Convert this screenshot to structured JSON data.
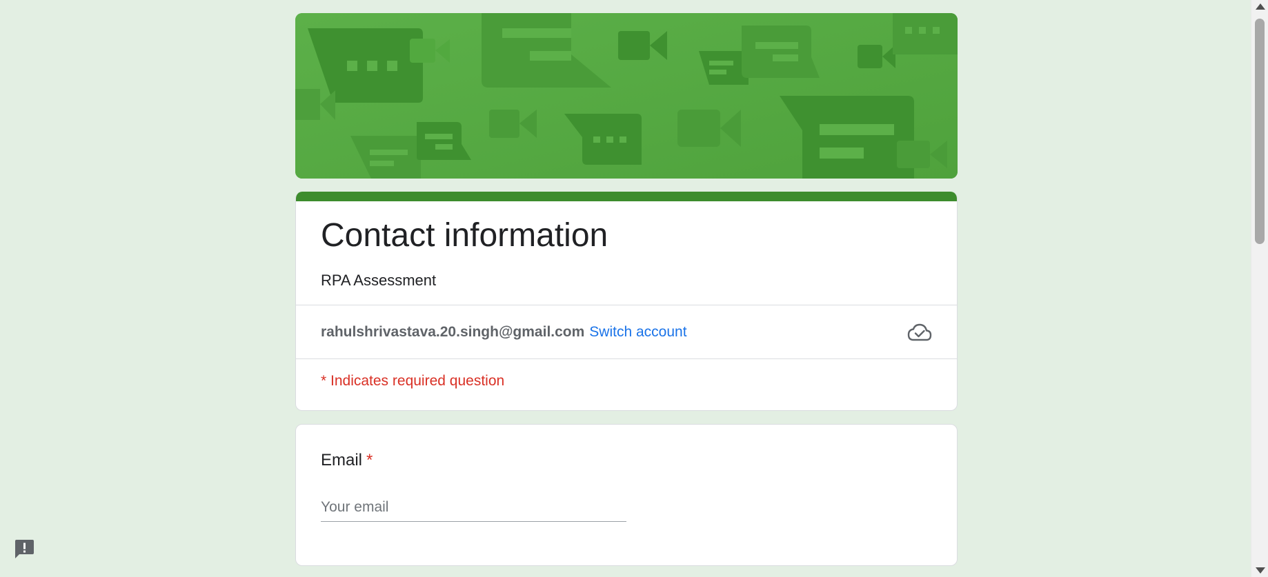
{
  "form": {
    "title": "Contact information",
    "description": "RPA Assessment",
    "account_email": "rahulshrivastava.20.singh@gmail.com",
    "switch_account_label": "Switch account",
    "required_note": "* Indicates required question"
  },
  "questions": [
    {
      "label": "Email",
      "required_marker": "*",
      "placeholder": "Your email",
      "value": ""
    }
  ],
  "icons": {
    "cloud": "cloud-done-icon",
    "feedback": "report-feedback-icon"
  },
  "colors": {
    "page_background": "#e3efe3",
    "banner": "#59ab45",
    "accent": "#3d8c2d",
    "link": "#1a73e8",
    "required": "#d93025"
  }
}
